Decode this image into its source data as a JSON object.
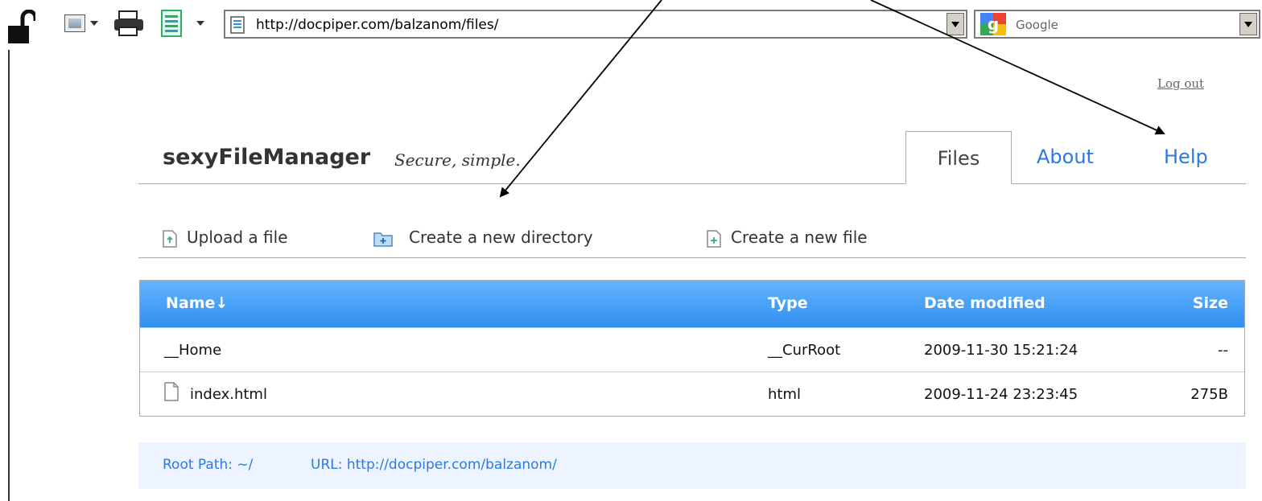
{
  "browser": {
    "url": "http://docpiper.com/balzanom/files/",
    "search_placeholder": "Google",
    "icons": [
      "lock-icon",
      "image-icon",
      "printer-icon",
      "page-icon",
      "google-icon"
    ]
  },
  "header": {
    "logout_label": "Log out",
    "brand": "sexyFileManager",
    "tagline": "Secure, simple.",
    "tabs": [
      {
        "label": "Files",
        "active": true
      },
      {
        "label": "About",
        "active": false
      },
      {
        "label": "Help",
        "active": false
      }
    ]
  },
  "actions": [
    {
      "label": "Upload a file",
      "icon": "upload-file-icon"
    },
    {
      "label": "Create a new directory",
      "icon": "new-folder-icon"
    },
    {
      "label": "Create a new file",
      "icon": "new-file-icon"
    }
  ],
  "table": {
    "columns": [
      "Name↓",
      "Type",
      "Date modified",
      "Size"
    ],
    "rows": [
      {
        "name": "__Home",
        "type": "__CurRoot",
        "date": "2009-11-30 15:21:24",
        "size": "--"
      },
      {
        "name": "index.html",
        "type": "html",
        "date": "2009-11-24 23:23:45",
        "size": "275B",
        "icon": "file-icon"
      }
    ]
  },
  "footer": {
    "root_path": "Root Path: ~/",
    "url": "URL: http://docpiper.com/balzanom/"
  },
  "colors": {
    "accent": "#2a7ae2",
    "table_header": "#3c9af5",
    "footer_bg": "#eef4ff"
  }
}
